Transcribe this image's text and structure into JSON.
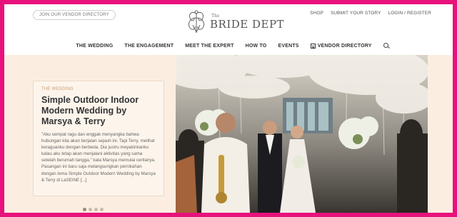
{
  "header": {
    "vendor_cta": "JOIN OUR VENDOR DIRECTORY",
    "logo_the": "The",
    "logo_name": "BRIDE DEPT",
    "links": [
      "SHOP",
      "SUBMIT YOUR STORY",
      "LOGIN / REGISTER"
    ]
  },
  "nav": {
    "items": [
      "THE WEDDING",
      "THE ENGAGEMENT",
      "MEET THE EXPERT",
      "HOW TO",
      "EVENTS"
    ],
    "vendor_directory": "VENDOR DIRECTORY",
    "vendor_icon": "grid-icon",
    "search_icon": "search-icon"
  },
  "featured": {
    "category": "THE WEDDING",
    "title": "Simple Outdoor Indoor Modern Wedding by Marsya & Terry",
    "excerpt": "\"Aku sempat ragu dan enggak menyangka bahwa hubungan kita akan berjalan sejauh ini. Tapi Terry, melihat keraguanku dengan berbeda. Dia justru meyakinkanku kalau aku tetap akan menjalani aktivitas yang sama setelah berumah tangga,\" kata Marsya memulai ceritanya. Pasangan ini baru saja melangsungkan pernikahan dengan tema Simple Outdoor Modern Wedding by Marsya & Terry di LaSEINE [...]"
  },
  "slider": {
    "total": 4,
    "active": 1
  },
  "colors": {
    "frame": "#e8127c",
    "hero_bg": "#fbeee1",
    "category": "#c89a6c"
  }
}
